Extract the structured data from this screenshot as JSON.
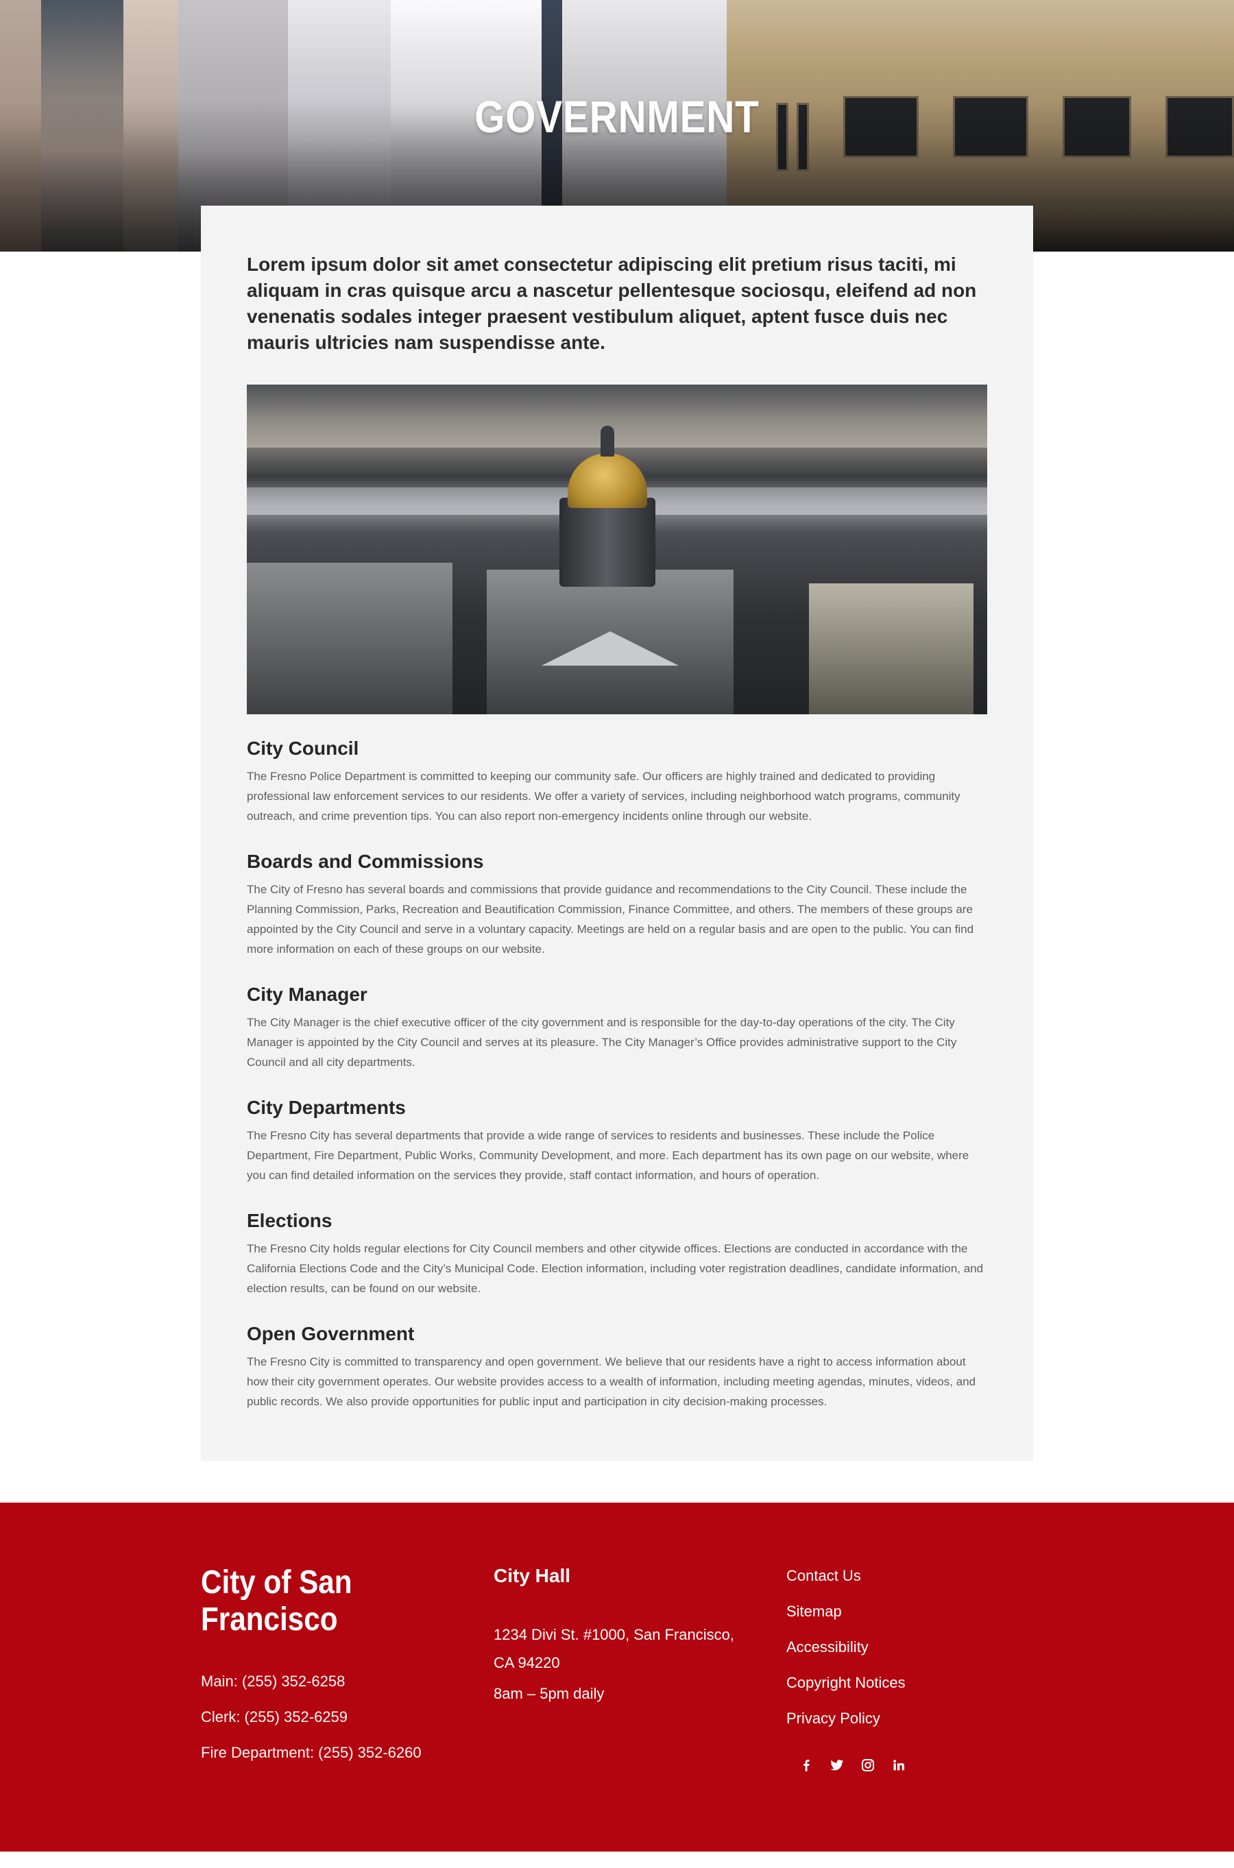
{
  "hero": {
    "title": "GOVERNMENT"
  },
  "intro": "Lorem ipsum dolor sit amet consectetur adipiscing elit pretium risus taciti, mi aliquam in cras quisque arcu a nascetur pellentesque sociosqu, eleifend ad non venenatis sodales integer praesent vestibulum aliquet, aptent fusce duis nec mauris ultricies nam suspendisse ante.",
  "feature_image": {
    "alt": "Aerial view of a domed cathedral and city skyline"
  },
  "sections": [
    {
      "title": "City Council",
      "body": "The Fresno Police Department is committed to keeping our community safe. Our officers are highly trained and dedicated to providing professional law enforcement services to our residents. We offer a variety of services, including neighborhood watch programs, community outreach, and crime prevention tips. You can also report non-emergency incidents online through our website."
    },
    {
      "title": "Boards and Commissions",
      "body": "The City of Fresno has several boards and commissions that provide guidance and recommendations to the City Council. These include the Planning Commission, Parks, Recreation and Beautification Commission, Finance Committee, and others. The members of these groups are appointed by the City Council and serve in a voluntary capacity. Meetings are held on a regular basis and are open to the public. You can find more information on each of these groups on our website."
    },
    {
      "title": "City Manager",
      "body": "The City Manager is the chief executive officer of the city government and is responsible for the day-to-day operations of the city. The City Manager is appointed by the City Council and serves at its pleasure. The City Manager’s Office provides administrative support to the City Council and all city departments."
    },
    {
      "title": "City Departments",
      "body": "The Fresno City has several departments that provide a wide range of services to residents and businesses. These include the Police Department, Fire Department, Public Works, Community Development, and more. Each department has its own page on our website, where you can find detailed information on the services they provide, staff contact information, and hours of operation."
    },
    {
      "title": "Elections",
      "body": "The Fresno City holds regular elections for City Council members and other citywide offices. Elections are conducted in accordance with the California Elections Code and the City’s Municipal Code. Election information, including voter registration deadlines, candidate information, and election results, can be found on our website."
    },
    {
      "title": "Open Government",
      "body": "The Fresno City is committed to transparency and open government. We believe that our residents have a right to access information about how their city government operates. Our website provides access to a wealth of information, including meeting agendas, minutes, videos, and public records. We also provide opportunities for public input and participation in city decision-making processes."
    }
  ],
  "footer": {
    "brand": "City of San Francisco",
    "phones": [
      "Main: (255) 352-6258",
      "Clerk: (255) 352-6259",
      "Fire Department: (255) 352-6260"
    ],
    "city_hall": {
      "heading": "City Hall",
      "address": "1234 Divi St. #1000, San Francisco, CA 94220",
      "hours": "8am – 5pm daily"
    },
    "links": [
      "Contact Us",
      "Sitemap",
      "Accessibility",
      "Copyright Notices",
      "Privacy Policy"
    ],
    "social": [
      "facebook-icon",
      "twitter-icon",
      "instagram-icon",
      "linkedin-icon"
    ],
    "background_color": "#b3050f"
  },
  "colors": {
    "card_background": "#f3f3f3",
    "heading_text": "#262626",
    "body_text": "#5e5e5e",
    "footer_red": "#b3050f"
  }
}
